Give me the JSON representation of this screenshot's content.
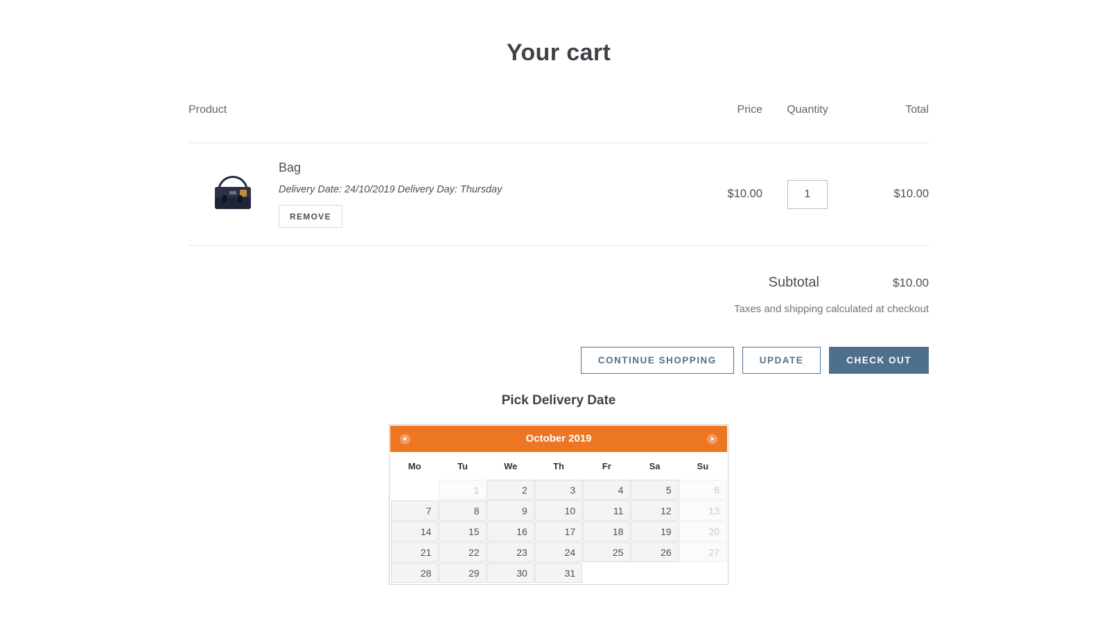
{
  "page": {
    "title": "Your cart"
  },
  "cart": {
    "columns": {
      "product": "Product",
      "price": "Price",
      "quantity": "Quantity",
      "total": "Total"
    },
    "items": [
      {
        "name": "Bag",
        "meta": "Delivery Date: 24/10/2019 Delivery Day: Thursday",
        "remove_label": "REMOVE",
        "price": "$10.00",
        "quantity": "1",
        "total": "$10.00",
        "thumbnail_alt": "navy-messenger-bag"
      }
    ],
    "summary": {
      "subtotal_label": "Subtotal",
      "subtotal_value": "$10.00",
      "tax_note": "Taxes and shipping calculated at checkout"
    },
    "actions": {
      "continue_shopping": "CONTINUE SHOPPING",
      "update": "UPDATE",
      "check_out": "CHECK OUT"
    }
  },
  "delivery_picker": {
    "title": "Pick Delivery Date",
    "calendar": {
      "month_label": "October 2019",
      "prev_icon": "chevron-left-icon",
      "next_icon": "chevron-right-icon",
      "weekday_headers": [
        "Mo",
        "Tu",
        "We",
        "Th",
        "Fr",
        "Sa",
        "Su"
      ],
      "weeks": [
        [
          {
            "day": "",
            "state": "empty"
          },
          {
            "day": "1",
            "state": "disabled"
          },
          {
            "day": "2",
            "state": "enabled"
          },
          {
            "day": "3",
            "state": "enabled"
          },
          {
            "day": "4",
            "state": "enabled"
          },
          {
            "day": "5",
            "state": "enabled"
          },
          {
            "day": "6",
            "state": "disabled"
          }
        ],
        [
          {
            "day": "7",
            "state": "enabled"
          },
          {
            "day": "8",
            "state": "enabled"
          },
          {
            "day": "9",
            "state": "enabled"
          },
          {
            "day": "10",
            "state": "enabled"
          },
          {
            "day": "11",
            "state": "enabled"
          },
          {
            "day": "12",
            "state": "enabled"
          },
          {
            "day": "13",
            "state": "disabled"
          }
        ],
        [
          {
            "day": "14",
            "state": "enabled"
          },
          {
            "day": "15",
            "state": "enabled"
          },
          {
            "day": "16",
            "state": "enabled"
          },
          {
            "day": "17",
            "state": "enabled"
          },
          {
            "day": "18",
            "state": "enabled"
          },
          {
            "day": "19",
            "state": "enabled"
          },
          {
            "day": "20",
            "state": "disabled"
          }
        ],
        [
          {
            "day": "21",
            "state": "enabled"
          },
          {
            "day": "22",
            "state": "enabled"
          },
          {
            "day": "23",
            "state": "enabled"
          },
          {
            "day": "24",
            "state": "enabled"
          },
          {
            "day": "25",
            "state": "enabled"
          },
          {
            "day": "26",
            "state": "enabled"
          },
          {
            "day": "27",
            "state": "disabled"
          }
        ],
        [
          {
            "day": "28",
            "state": "enabled"
          },
          {
            "day": "29",
            "state": "enabled"
          },
          {
            "day": "30",
            "state": "enabled"
          },
          {
            "day": "31",
            "state": "enabled"
          },
          {
            "day": "",
            "state": "empty"
          },
          {
            "day": "",
            "state": "empty"
          },
          {
            "day": "",
            "state": "empty"
          }
        ]
      ]
    }
  },
  "colors": {
    "accent_orange": "#ed7623",
    "button_blue": "#4f6f8f",
    "text_dark": "#3d4246",
    "text_muted": "#6f7477"
  }
}
